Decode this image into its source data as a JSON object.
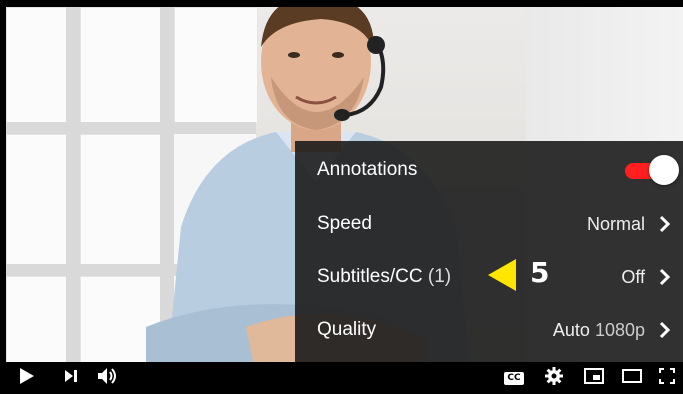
{
  "menu": {
    "items": [
      {
        "label": "Annotations",
        "type": "toggle",
        "on": true
      },
      {
        "label": "Speed",
        "value": "Normal"
      },
      {
        "label": "Subtitles/CC",
        "count": "(1)",
        "value": "Off"
      },
      {
        "label": "Quality",
        "value": "Auto",
        "value_sub": "1080p"
      }
    ]
  },
  "annotation": {
    "number": "5",
    "color": "#ffe600"
  },
  "colors": {
    "toggle_on": "#ff1f1f",
    "menu_bg": "#1c1c1c"
  },
  "controls": {
    "icons": [
      "play-icon",
      "next-icon",
      "volume-icon",
      "subtitles-icon",
      "settings-gear-icon",
      "miniplayer-icon",
      "theater-mode-icon",
      "fullscreen-icon"
    ],
    "cc_text": "CC"
  }
}
